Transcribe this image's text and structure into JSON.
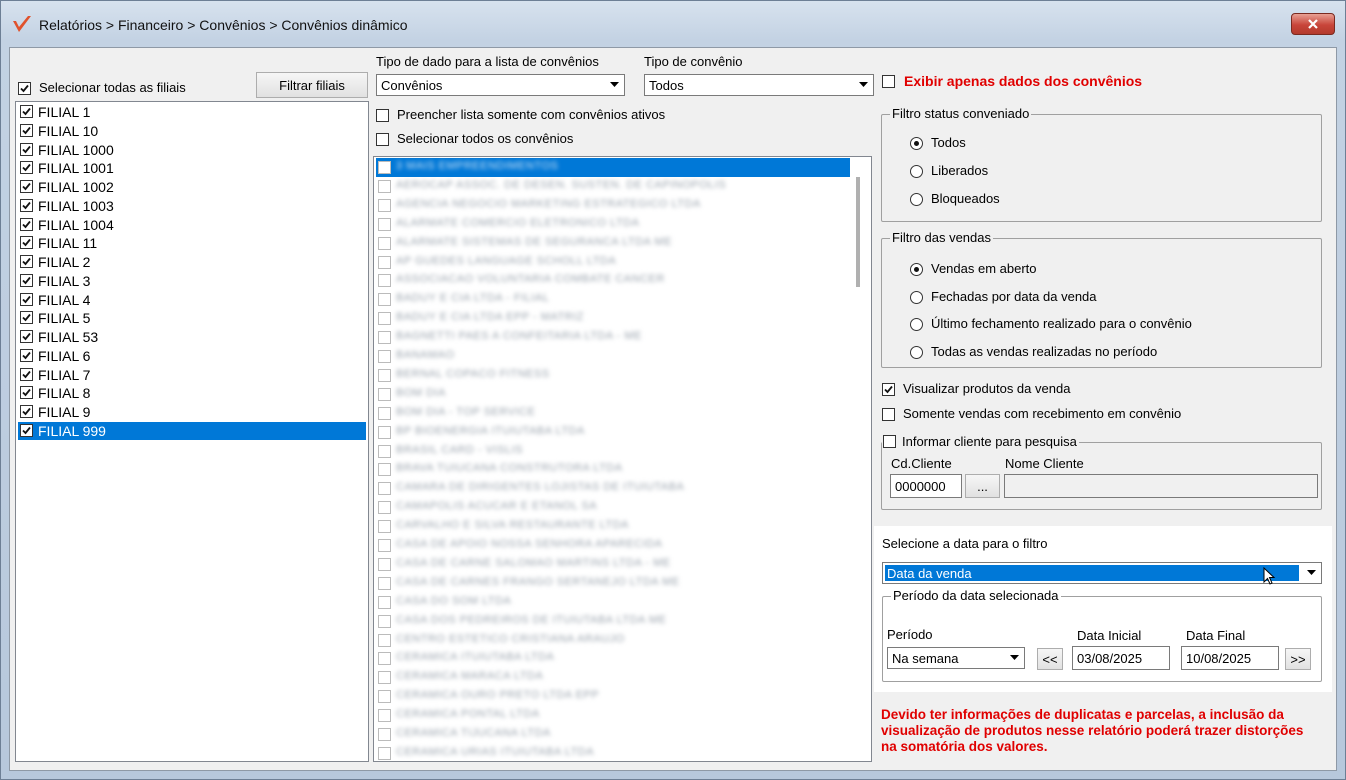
{
  "window": {
    "title": "Relatórios > Financeiro > Convênios > Convênios dinâmico"
  },
  "filiais": {
    "select_all_label": "Selecionar todas as filiais",
    "select_all_checked": true,
    "filter_button": "Filtrar filiais",
    "items": [
      {
        "label": "FILIAL 1",
        "checked": true
      },
      {
        "label": "FILIAL 10",
        "checked": true
      },
      {
        "label": "FILIAL 1000",
        "checked": true
      },
      {
        "label": "FILIAL 1001",
        "checked": true
      },
      {
        "label": "FILIAL 1002",
        "checked": true
      },
      {
        "label": "FILIAL 1003",
        "checked": true
      },
      {
        "label": "FILIAL 1004",
        "checked": true
      },
      {
        "label": "FILIAL 11",
        "checked": true
      },
      {
        "label": "FILIAL 2",
        "checked": true
      },
      {
        "label": "FILIAL 3",
        "checked": true
      },
      {
        "label": "FILIAL 4",
        "checked": true
      },
      {
        "label": "FILIAL 5",
        "checked": true
      },
      {
        "label": "FILIAL 53",
        "checked": true
      },
      {
        "label": "FILIAL 6",
        "checked": true
      },
      {
        "label": "FILIAL 7",
        "checked": true
      },
      {
        "label": "FILIAL 8",
        "checked": true
      },
      {
        "label": "FILIAL 9",
        "checked": true
      },
      {
        "label": "FILIAL 999",
        "checked": true,
        "selected": true
      }
    ]
  },
  "convenios": {
    "data_type_label": "Tipo de dado para a lista de convênios",
    "data_type_value": "Convênios",
    "type_label": "Tipo de convênio",
    "type_value": "Todos",
    "only_active_label": "Preencher lista somente com convênios ativos",
    "select_all_label": "Selecionar todos os convênios",
    "items": [
      "3 MAIS EMPREENDIMENTOS",
      "AEROCAP ASSOC. DE DESEN. SUSTEN. DE CAPINOPOLIS",
      "AGENCIA NEGOCIO MARKETING ESTRATEGICO LTDA",
      "ALARMATE COMERCIO ELETRONICO LTDA",
      "ALARMATE SISTEMAS DE SEGURANCA LTDA ME",
      "AP GUEDES LANGUAGE SCHOLL LTDA",
      "ASSOCIACAO VOLUNTARIA COMBATE CANCER",
      "BADUY E CIA LTDA - FILIAL",
      "BADUY E CIA LTDA EPP - MATRIZ",
      "BAGNETTI PAES A CONFEITARIA LTDA - ME",
      "BANAMAO",
      "BERNAL COPACO FITNESS",
      "BOM DIA",
      "BOM DIA - TOP SERVICE",
      "BP BIOENERGIA ITUIUTABA LTDA",
      "BRASIL CARD - VISLIS",
      "BRAVA TUIUCANA CONSTRUTORA LTDA",
      "CAMARA DE DIRIGENTES LOJISTAS DE ITUIUTABA",
      "CAMAPOLIS ACUCAR E ETANOL SA",
      "CARVALHO E SILVA RESTAURANTE LTDA",
      "CASA DE APOIO NOSSA SENHORA APARECIDA",
      "CASA DE CARNE SALOMAO MARTINS LTDA - ME",
      "CASA DE CARNES FRANGO SERTANEJO LTDA ME",
      "CASA DO SOM LTDA",
      "CASA DOS PEDREIROS DE ITUIUTABA LTDA ME",
      "CENTRO ESTETICO CRISTIANA ARAUJO",
      "CERAMICA ITUIUTABA LTDA",
      "CERAMICA MARACA LTDA",
      "CERAMICA OURO PRETO LTDA EPP",
      "CERAMICA PONTAL LTDA",
      "CERAMICA TIJUCANA LTDA",
      "CERAMICA URIAS ITUIUTABA LTDA"
    ]
  },
  "options": {
    "only_convenio_data_label": "Exibir apenas dados dos convênios",
    "status_group": {
      "title": "Filtro status conveniado",
      "options": [
        "Todos",
        "Liberados",
        "Bloqueados"
      ],
      "selected": "Todos"
    },
    "sales_group": {
      "title": "Filtro das vendas",
      "options": [
        "Vendas em aberto",
        "Fechadas por data da venda",
        "Último fechamento realizado para o convênio",
        "Todas as vendas realizadas no período"
      ],
      "selected": "Vendas em aberto"
    },
    "show_products_label": "Visualizar produtos da venda",
    "show_products_checked": true,
    "only_receipt_label": "Somente vendas com recebimento em convênio",
    "client_group": {
      "title": "Informar cliente para pesquisa",
      "code_label": "Cd.Cliente",
      "code_value": "0000000",
      "browse_label": "...",
      "name_label": "Nome Cliente",
      "name_value": ""
    }
  },
  "date_filter": {
    "select_label": "Selecione a data para o filtro",
    "select_value": "Data da venda",
    "period_group_title": "Período da data selecionada",
    "period_label": "Período",
    "period_value": "Na semana",
    "prev_label": "<<",
    "start_label": "Data Inicial",
    "start_value": "03/08/2025",
    "end_label": "Data Final",
    "end_value": "10/08/2025",
    "next_label": ">>"
  },
  "warning": "Devido ter informações de duplicatas e parcelas, a inclusão da visualização de produtos nesse relatório poderá trazer distorções na somatória dos valores.",
  "colors": {
    "selection": "#0078d7",
    "warning": "#e00000"
  }
}
